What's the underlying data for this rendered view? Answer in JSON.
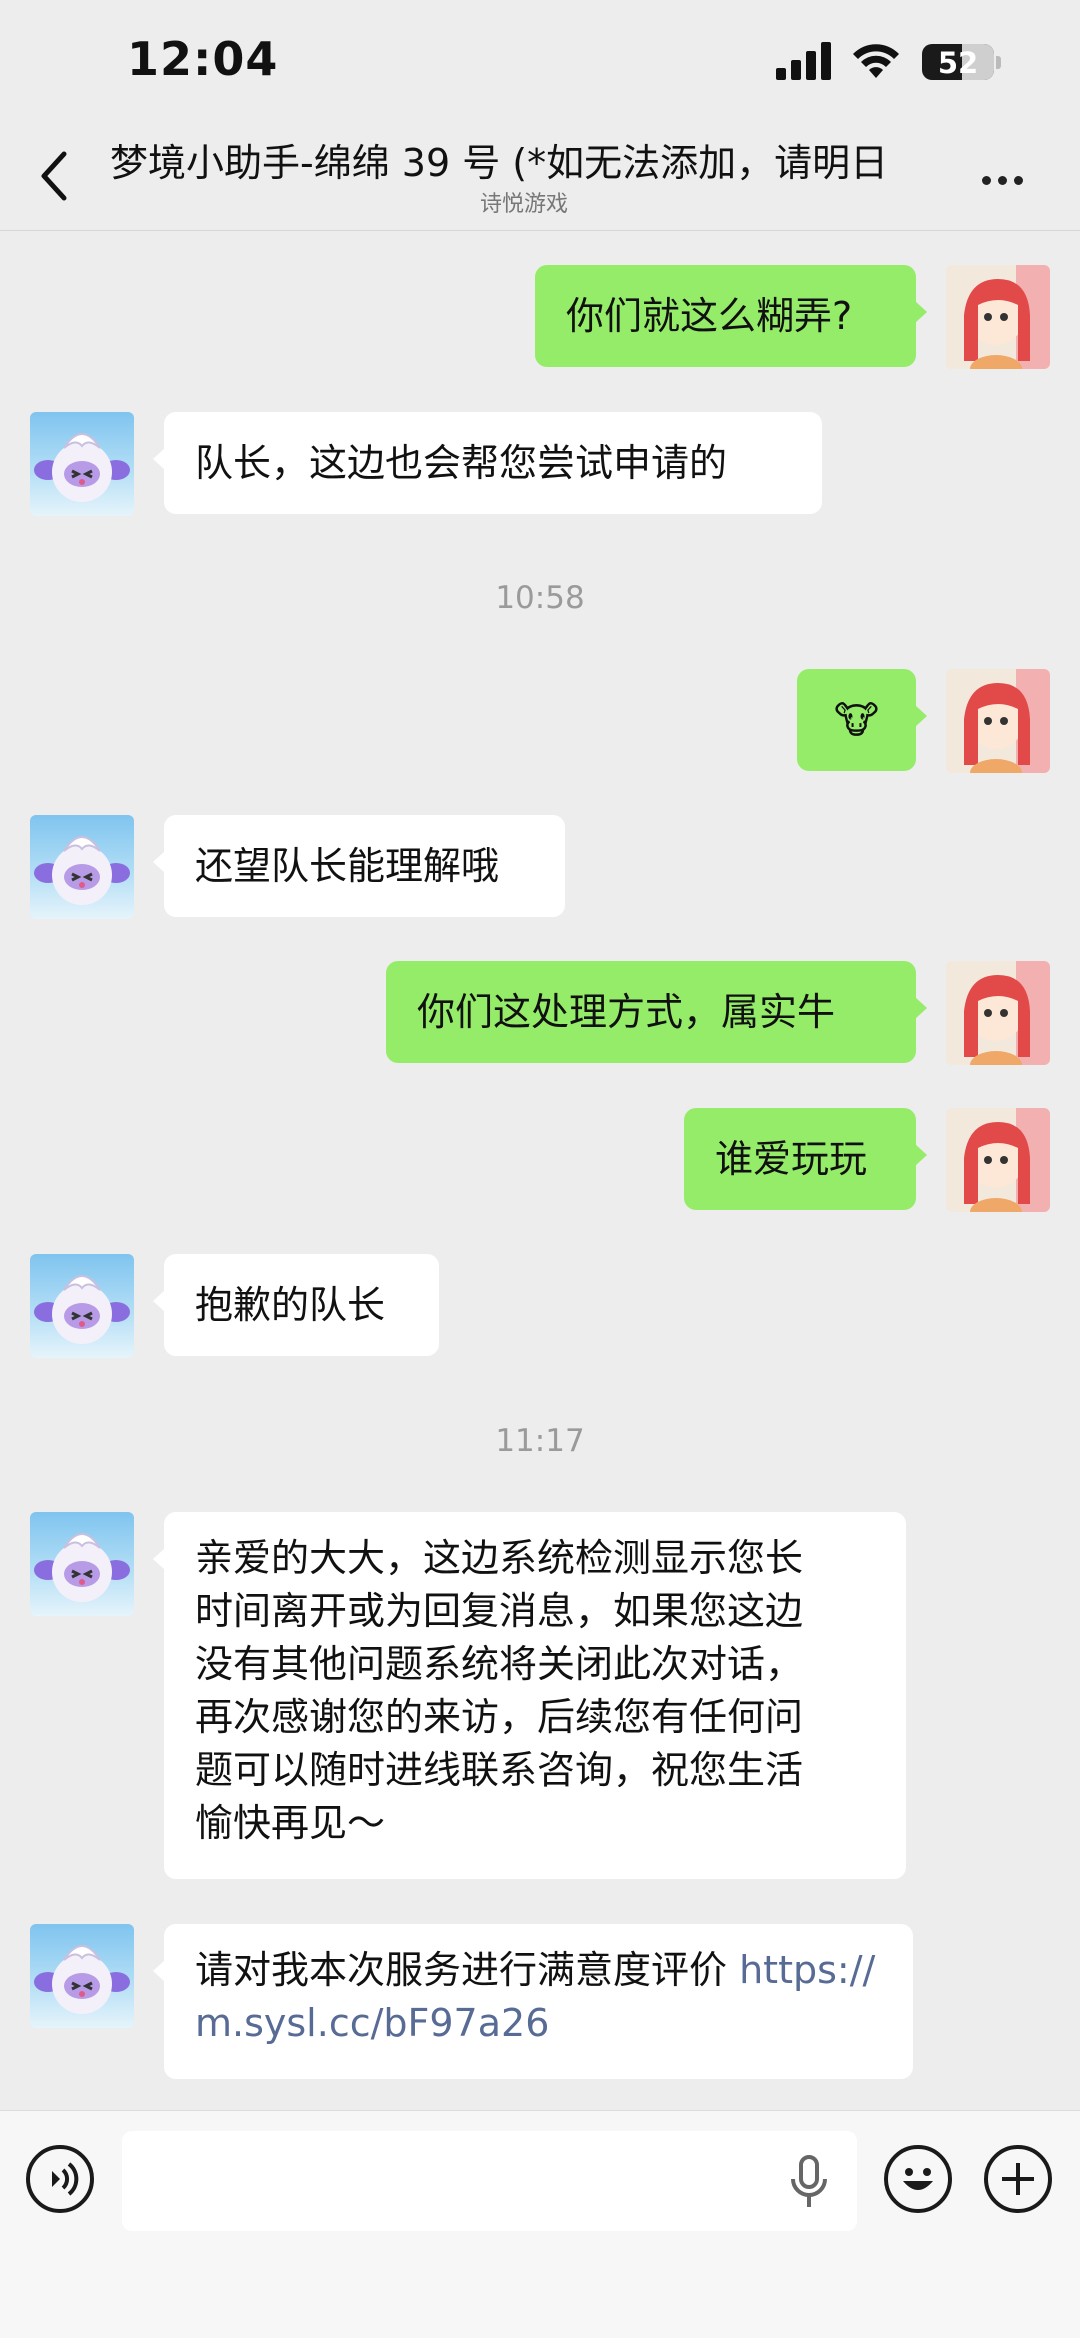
{
  "status_bar": {
    "time": "12:04",
    "battery_level": "52"
  },
  "nav": {
    "title": "梦境小助手-绵绵 39 号 (*如无法添加，请明日",
    "subtitle": "诗悦游戏"
  },
  "messages": [
    {
      "side": "right",
      "text": "你们就这么糊弄?"
    },
    {
      "side": "left",
      "text": "队长，这边也会帮您尝试申请的"
    },
    {
      "type": "time",
      "text": "10:58"
    },
    {
      "side": "right",
      "text": "🐮"
    },
    {
      "side": "left",
      "text": "还望队长能理解哦"
    },
    {
      "side": "right",
      "text": "你们这处理方式，属实牛"
    },
    {
      "side": "right",
      "text": "谁爱玩玩"
    },
    {
      "side": "left",
      "text": "抱歉的队长"
    },
    {
      "type": "time",
      "text": "11:17"
    },
    {
      "side": "left",
      "lines": [
        "亲爱的大大，这边系统检测显示您长",
        "时间离开或为回复消息，如果您这边",
        "没有其他问题系统将关闭此次对话，",
        "再次感谢您的来访，后续您有任何问",
        "题可以随时进线联系咨询，祝您生活",
        "愉快再见～"
      ]
    },
    {
      "side": "left",
      "text": "请对我本次服务进行满意度评价 ",
      "link": "https://m.sysl.cc/bF97a26"
    }
  ],
  "colors": {
    "own_bubble": "#95ec69",
    "other_bubble": "#ffffff",
    "link": "#576b95",
    "background": "#ededed"
  },
  "icons": [
    "back-icon",
    "more-icon",
    "voice-icon",
    "mic-icon",
    "emoji-icon",
    "plus-icon"
  ]
}
